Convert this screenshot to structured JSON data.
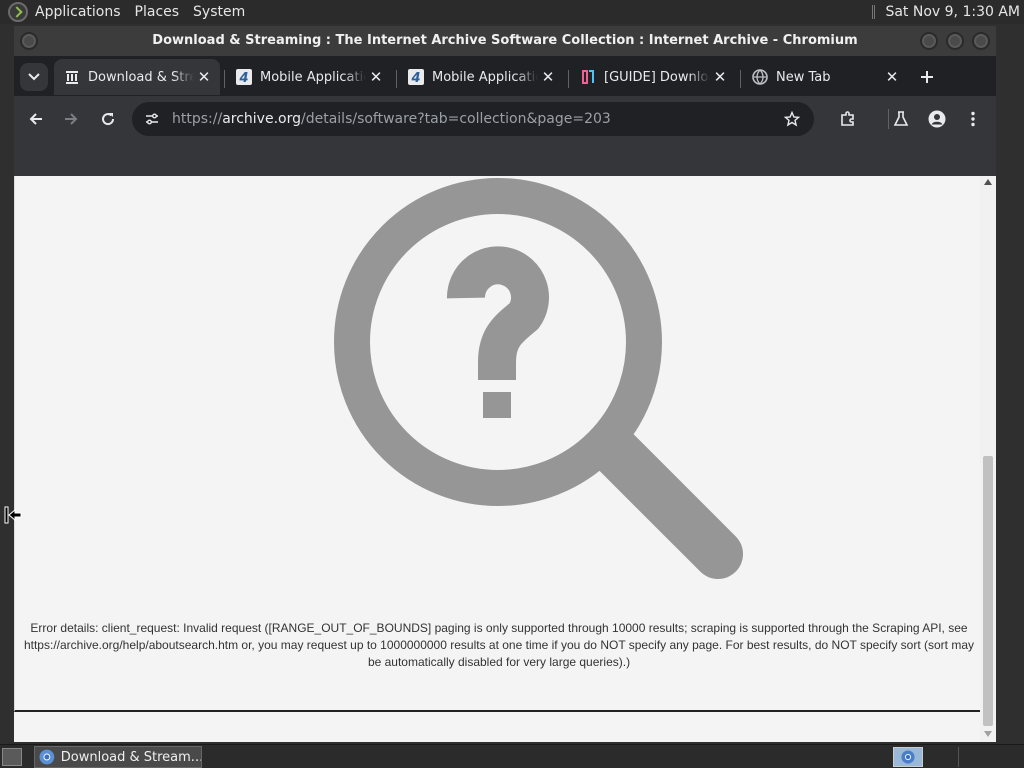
{
  "top_panel": {
    "menu": [
      "Applications",
      "Places",
      "System"
    ],
    "clock": "Sat Nov  9,  1:30 AM"
  },
  "window": {
    "title": "Download & Streaming : The Internet Archive Software Collection : Internet Archive - Chromium"
  },
  "tabs": [
    {
      "label": "Download & Streaming",
      "icon": "archive-icon",
      "active": true
    },
    {
      "label": "Mobile Applications",
      "icon": "4pda-icon",
      "active": false
    },
    {
      "label": "Mobile Applications",
      "icon": "4pda-icon",
      "active": false
    },
    {
      "label": "[GUIDE] Download",
      "icon": "guide-icon",
      "active": false
    },
    {
      "label": "New Tab",
      "icon": "globe-icon",
      "active": false
    }
  ],
  "toolbar": {
    "url_scheme": "https://",
    "url_host": "archive.org",
    "url_path": "/details/software?tab=collection&page=203"
  },
  "page": {
    "error_details": "Error details: client_request: Invalid request ([RANGE_OUT_OF_BOUNDS] paging is only supported through 10000 results; scraping is supported through the Scraping API, see https://archive.org/help/aboutsearch.htm or, you may request up to 1000000000 results at one time if you do NOT specify any page. For best results, do NOT specify sort (sort may be automatically disabled for very large queries).)"
  },
  "taskbar": {
    "task_label": "Download & Stream..."
  },
  "colors": {
    "magnifier_gray": "#969696",
    "page_bg": "#f4f4f4",
    "tab_strip": "#202124",
    "toolbar": "#35363a"
  }
}
